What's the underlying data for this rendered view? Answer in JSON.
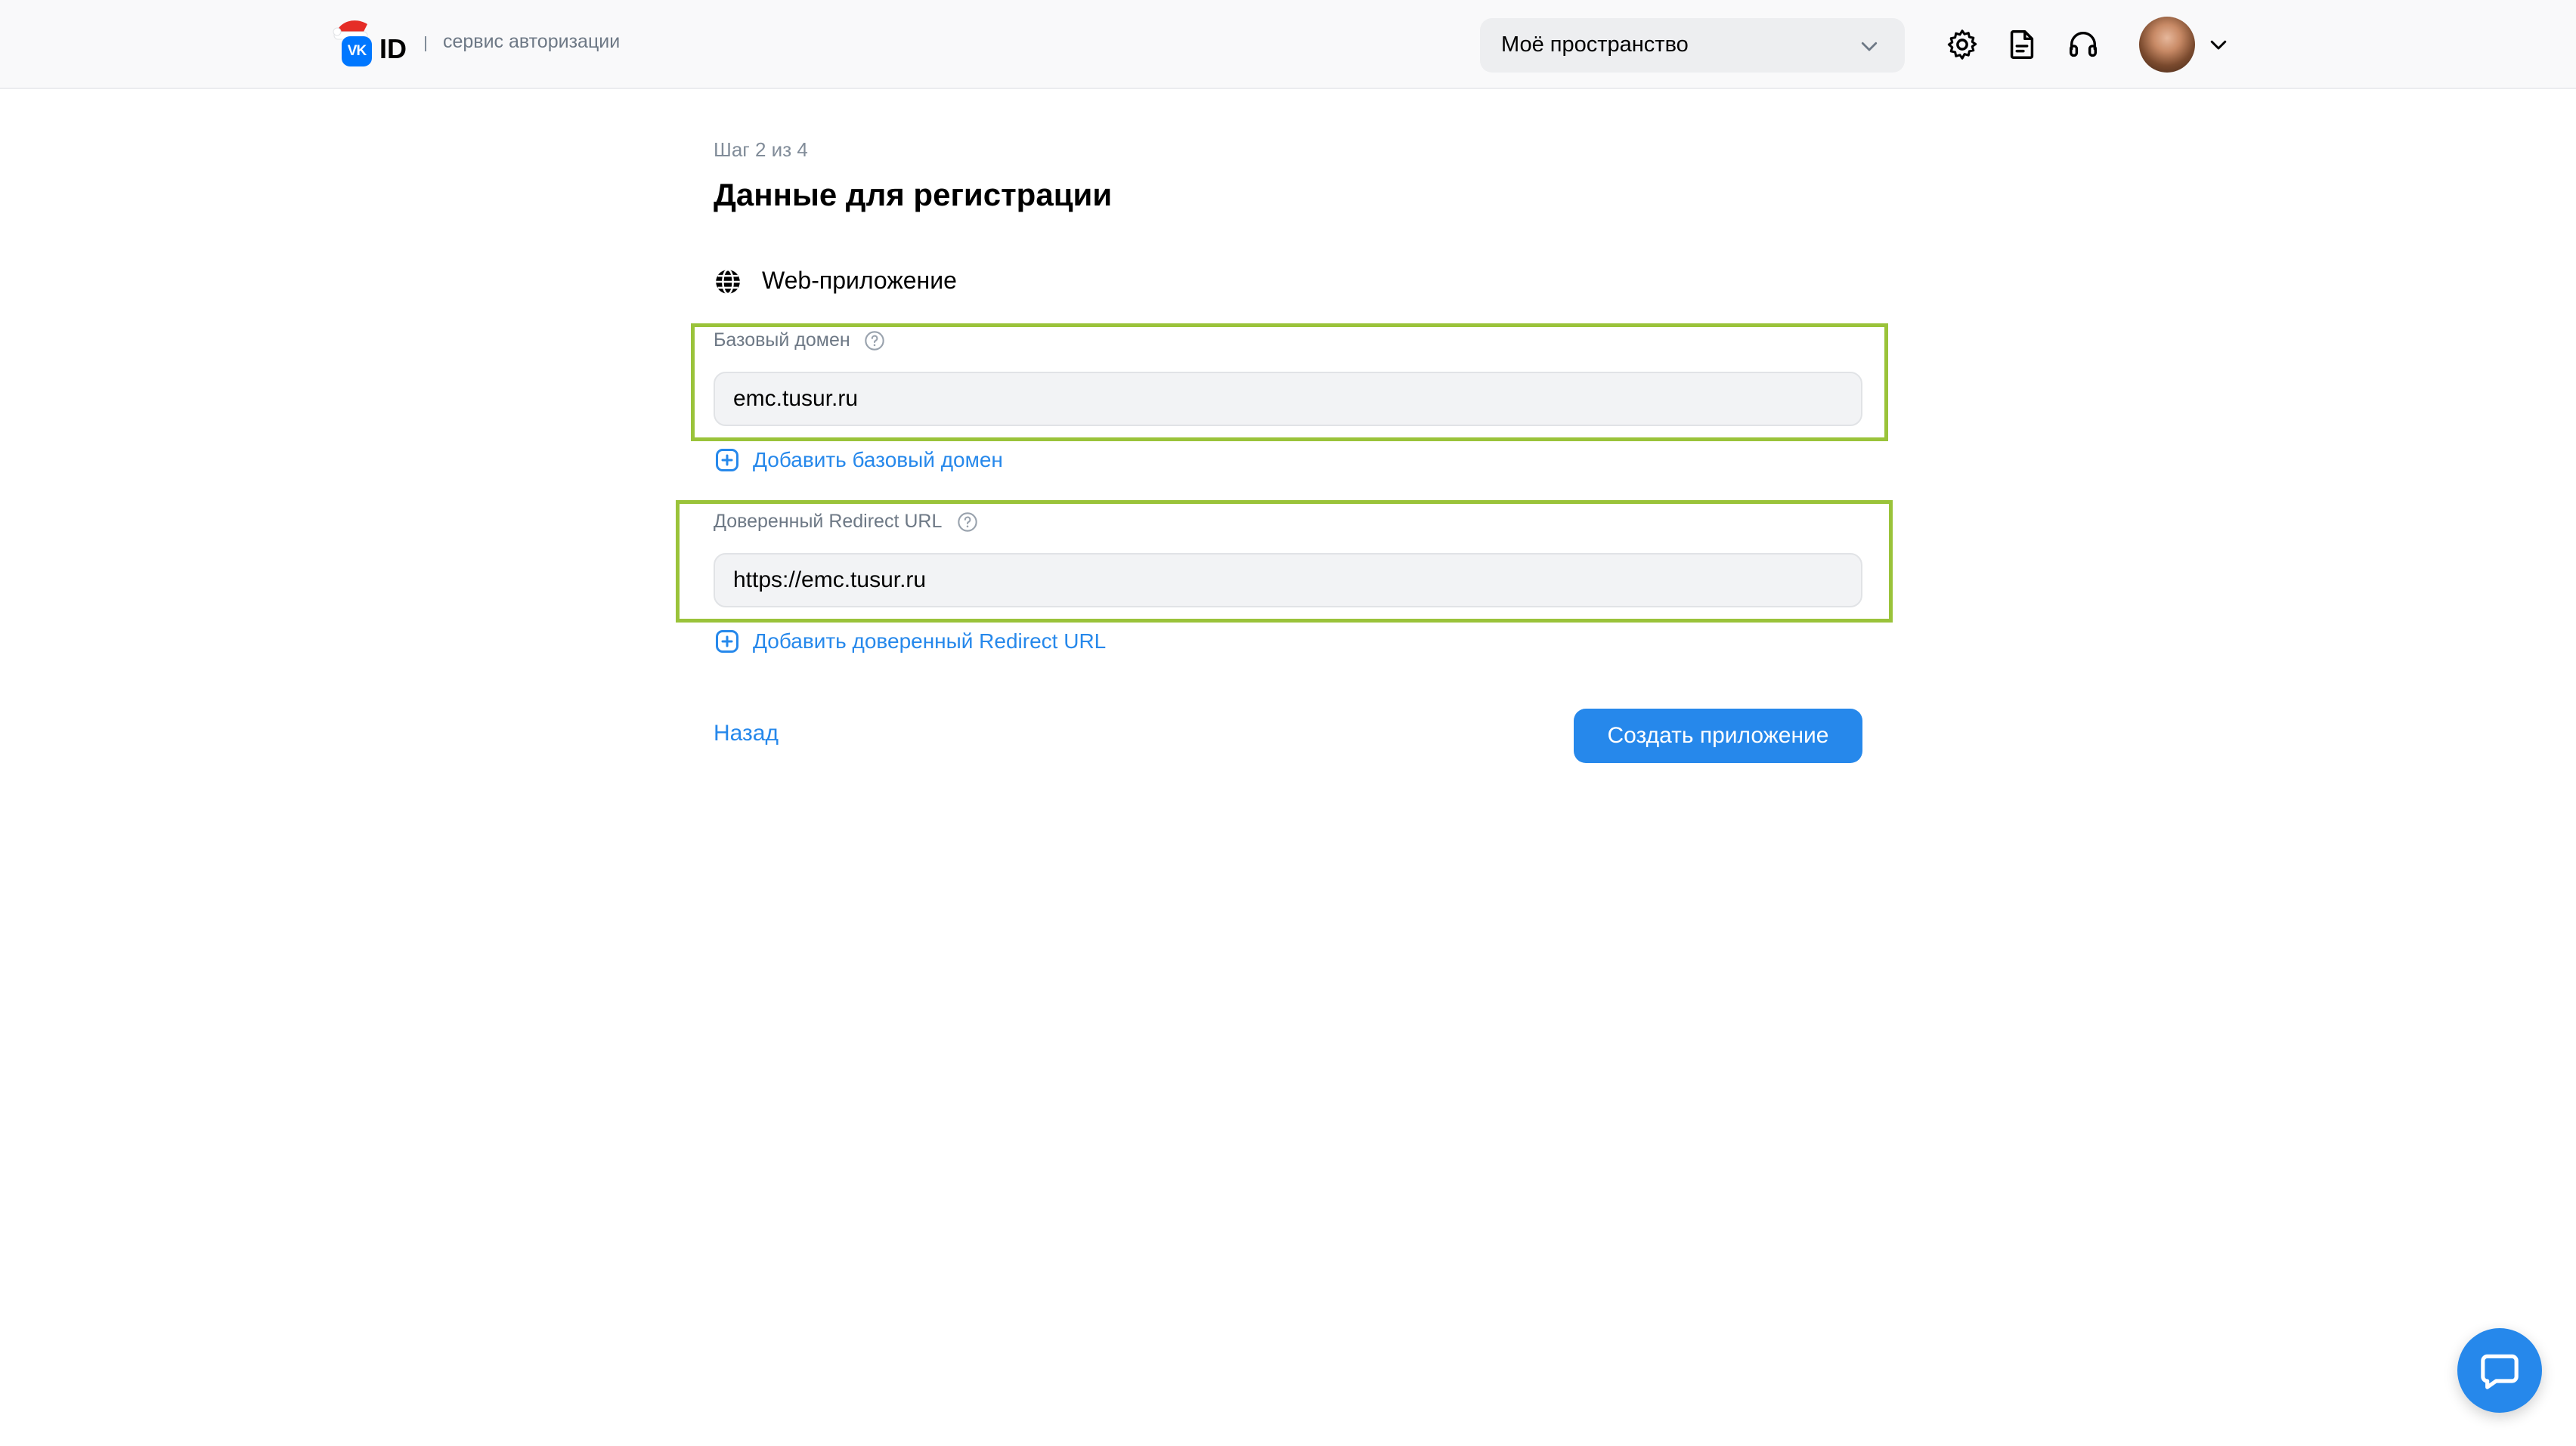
{
  "header": {
    "logo_mark": "VK",
    "logo_text": "ID",
    "service_caption": "сервис авторизации",
    "workspace_select": {
      "value": "Моё пространство",
      "icon": "chevron-down-icon"
    },
    "icons": [
      "gear-icon",
      "document-icon",
      "headset-icon",
      "avatar",
      "chevron-down-icon"
    ]
  },
  "main": {
    "step": "Шаг 2 из 4",
    "title": "Данные для регистрации",
    "platform": {
      "icon": "globe-icon",
      "label": "Web-приложение"
    },
    "base_domain": {
      "label": "Базовый домен",
      "value": "emc.tusur.ru",
      "add_label": "Добавить базовый домен"
    },
    "redirect_url": {
      "label": "Доверенный Redirect URL",
      "value": "https://emc.tusur.ru",
      "add_label": "Добавить доверенный Redirect URL"
    },
    "back_label": "Назад",
    "create_label": "Создать приложение"
  },
  "colors": {
    "accent": "#2688eb",
    "highlight": "#9ac33a",
    "header_bg": "#f9f9fa",
    "input_bg": "#f2f3f5",
    "secondary_text": "#818c99"
  }
}
